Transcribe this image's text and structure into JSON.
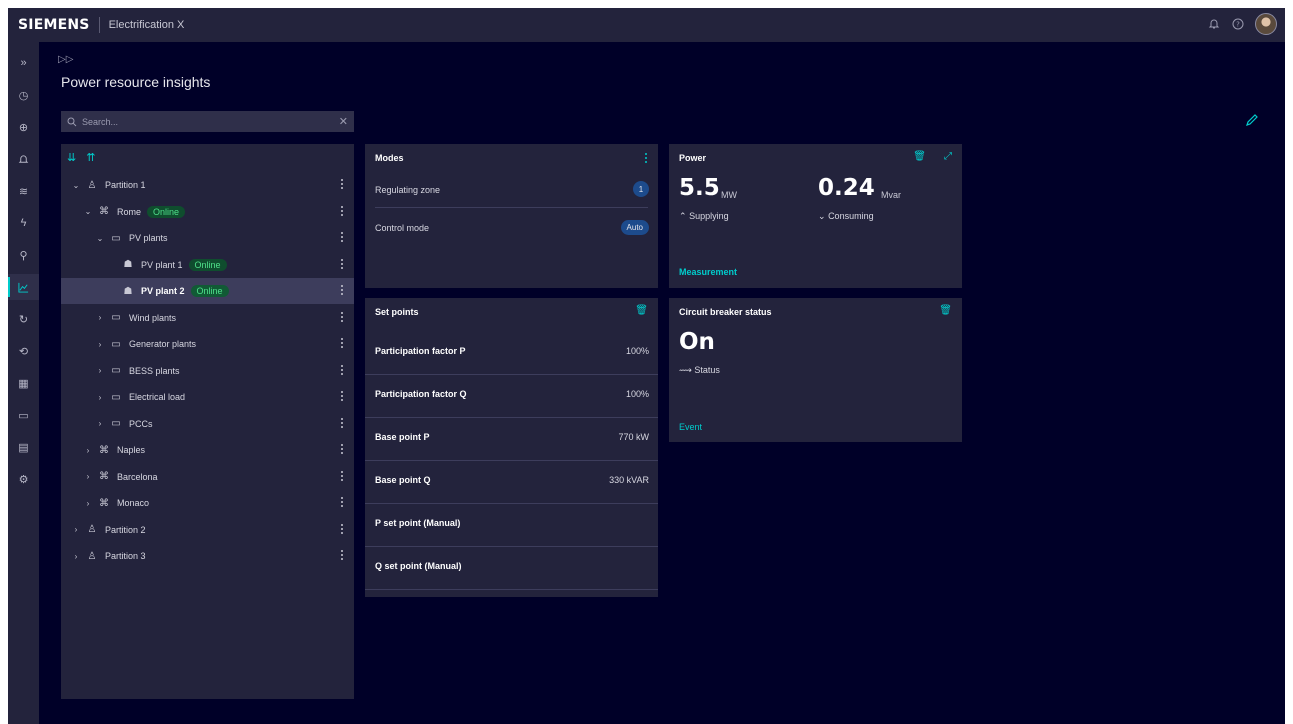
{
  "app": {
    "brand": "SIEMENS",
    "name": "Electrification X"
  },
  "colors": {
    "accent": "#00cccc",
    "background": "#000028",
    "panel": "#23233c",
    "online": "#4fe08a",
    "chip": "#1d4b8c"
  },
  "topbar": {
    "icons": [
      "bell-icon",
      "help-icon",
      "avatar"
    ]
  },
  "rail": {
    "icons": [
      "expand-icon",
      "clock-icon",
      "globe-icon",
      "bell-icon",
      "layers-icon",
      "lightning-icon",
      "user-hierarchy-icon",
      "chart-icon",
      "sync-icon",
      "refresh-icon",
      "calendar-icon",
      "document-icon",
      "report-icon",
      "settings-icon"
    ],
    "active": "chart-icon"
  },
  "page": {
    "title": "Power resource insights"
  },
  "search": {
    "placeholder": "Search..."
  },
  "tree": {
    "items": [
      {
        "label": "Partition 1",
        "level": 0,
        "expanded": true,
        "icon": "partition-icon"
      },
      {
        "label": "Rome",
        "level": 1,
        "expanded": true,
        "icon": "plant-network-icon",
        "badge": "Online"
      },
      {
        "label": "PV plants",
        "level": 2,
        "expanded": true,
        "icon": "folder-icon"
      },
      {
        "label": "PV plant 1",
        "level": 3,
        "icon": "pv-icon",
        "badge": "Online"
      },
      {
        "label": "PV plant 2",
        "level": 3,
        "icon": "pv-icon",
        "badge": "Online",
        "selected": true
      },
      {
        "label": "Wind plants",
        "level": 2,
        "expanded": false,
        "icon": "folder-icon"
      },
      {
        "label": "Generator plants",
        "level": 2,
        "expanded": false,
        "icon": "folder-icon"
      },
      {
        "label": "BESS plants",
        "level": 2,
        "expanded": false,
        "icon": "folder-icon"
      },
      {
        "label": "Electrical load",
        "level": 2,
        "expanded": false,
        "icon": "folder-icon"
      },
      {
        "label": "PCCs",
        "level": 2,
        "expanded": false,
        "icon": "folder-icon"
      },
      {
        "label": "Naples",
        "level": 1,
        "expanded": false,
        "icon": "plant-network-icon"
      },
      {
        "label": "Barcelona",
        "level": 1,
        "expanded": false,
        "icon": "plant-network-icon"
      },
      {
        "label": "Monaco",
        "level": 1,
        "expanded": false,
        "icon": "plant-network-icon"
      },
      {
        "label": "Partition 2",
        "level": 0,
        "expanded": false,
        "icon": "partition-icon"
      },
      {
        "label": "Partition 3",
        "level": 0,
        "expanded": false,
        "icon": "partition-icon"
      }
    ]
  },
  "modes": {
    "title": "Modes",
    "regulating_zone_label": "Regulating zone",
    "regulating_zone_value": "1",
    "control_mode_label": "Control mode",
    "control_mode_value": "Auto"
  },
  "setpoints": {
    "title": "Set points",
    "rows": [
      {
        "label": "Participation factor P",
        "value": "100%"
      },
      {
        "label": "Participation factor Q",
        "value": "100%"
      },
      {
        "label": "Base point P",
        "value": "770 kW"
      },
      {
        "label": "Base point Q",
        "value": "330 kVAR"
      },
      {
        "label": "P set point (Manual)",
        "value": ""
      },
      {
        "label": "Q set point (Manual)",
        "value": ""
      }
    ]
  },
  "power": {
    "title": "Power",
    "supply_value": "5.5",
    "supply_unit": "MW",
    "supply_label": "Supplying",
    "consume_value": "0.24",
    "consume_unit": "Mvar",
    "consume_label": "Consuming",
    "footer": "Measurement"
  },
  "breaker": {
    "title": "Circuit breaker status",
    "value": "On",
    "label": "Status",
    "footer": "Event"
  }
}
